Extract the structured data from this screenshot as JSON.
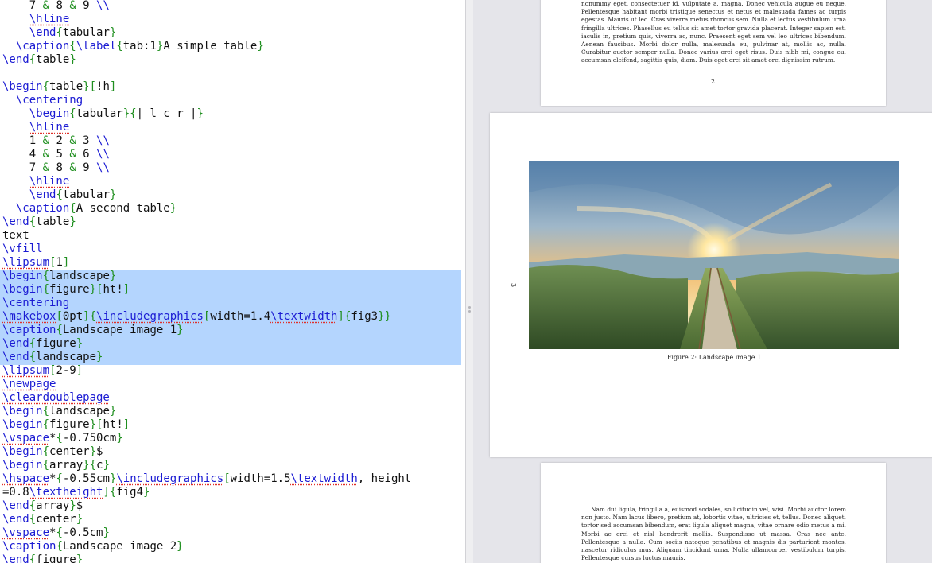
{
  "editor": {
    "lines": [
      [
        [
          "a",
          "    7 "
        ],
        [
          "b",
          "&"
        ],
        [
          "a",
          " 8 "
        ],
        [
          "b",
          "&"
        ],
        [
          "a",
          " 9 "
        ],
        [
          "c",
          "\\\\"
        ]
      ],
      [
        [
          "a",
          "    "
        ],
        [
          "u",
          "\\hline"
        ]
      ],
      [
        [
          "a",
          "    "
        ],
        [
          "c",
          "\\end"
        ],
        [
          "b",
          "{"
        ],
        [
          "a",
          "tabular"
        ],
        [
          "b",
          "}"
        ]
      ],
      [
        [
          "a",
          "  "
        ],
        [
          "c",
          "\\caption"
        ],
        [
          "b",
          "{"
        ],
        [
          "c",
          "\\label"
        ],
        [
          "b",
          "{"
        ],
        [
          "a",
          "tab:1"
        ],
        [
          "b",
          "}"
        ],
        [
          "a",
          "A simple table"
        ],
        [
          "b",
          "}"
        ]
      ],
      [
        [
          "c",
          "\\end"
        ],
        [
          "b",
          "{"
        ],
        [
          "a",
          "table"
        ],
        [
          "b",
          "}"
        ]
      ],
      [
        [
          "a",
          ""
        ]
      ],
      [
        [
          "c",
          "\\begin"
        ],
        [
          "b",
          "{"
        ],
        [
          "a",
          "table"
        ],
        [
          "b",
          "}"
        ],
        [
          "b",
          "["
        ],
        [
          "a",
          "!h"
        ],
        [
          "b",
          "]"
        ]
      ],
      [
        [
          "a",
          "  "
        ],
        [
          "c",
          "\\centering"
        ]
      ],
      [
        [
          "a",
          "    "
        ],
        [
          "c",
          "\\begin"
        ],
        [
          "b",
          "{"
        ],
        [
          "a",
          "tabular"
        ],
        [
          "b",
          "}"
        ],
        [
          "b",
          "{"
        ],
        [
          "a",
          "| l c r |"
        ],
        [
          "b",
          "}"
        ]
      ],
      [
        [
          "a",
          "    "
        ],
        [
          "u",
          "\\hline"
        ]
      ],
      [
        [
          "a",
          "    1 "
        ],
        [
          "b",
          "&"
        ],
        [
          "a",
          " 2 "
        ],
        [
          "b",
          "&"
        ],
        [
          "a",
          " 3 "
        ],
        [
          "c",
          "\\\\"
        ]
      ],
      [
        [
          "a",
          "    4 "
        ],
        [
          "b",
          "&"
        ],
        [
          "a",
          " 5 "
        ],
        [
          "b",
          "&"
        ],
        [
          "a",
          " 6 "
        ],
        [
          "c",
          "\\\\"
        ]
      ],
      [
        [
          "a",
          "    7 "
        ],
        [
          "b",
          "&"
        ],
        [
          "a",
          " 8 "
        ],
        [
          "b",
          "&"
        ],
        [
          "a",
          " 9 "
        ],
        [
          "c",
          "\\\\"
        ]
      ],
      [
        [
          "a",
          "    "
        ],
        [
          "u",
          "\\hline"
        ]
      ],
      [
        [
          "a",
          "    "
        ],
        [
          "c",
          "\\end"
        ],
        [
          "b",
          "{"
        ],
        [
          "a",
          "tabular"
        ],
        [
          "b",
          "}"
        ]
      ],
      [
        [
          "a",
          "  "
        ],
        [
          "c",
          "\\caption"
        ],
        [
          "b",
          "{"
        ],
        [
          "a",
          "A second table"
        ],
        [
          "b",
          "}"
        ]
      ],
      [
        [
          "c",
          "\\end"
        ],
        [
          "b",
          "{"
        ],
        [
          "a",
          "table"
        ],
        [
          "b",
          "}"
        ]
      ],
      [
        [
          "a",
          "text"
        ]
      ],
      [
        [
          "c",
          "\\vfill"
        ]
      ],
      [
        [
          "u",
          "\\lipsum"
        ],
        [
          "b",
          "["
        ],
        [
          "a",
          "1"
        ],
        [
          "b",
          "]"
        ]
      ],
      [
        [
          "c",
          "\\begin"
        ],
        [
          "b",
          "{"
        ],
        [
          "a",
          "landscape"
        ],
        [
          "b",
          "}"
        ]
      ],
      [
        [
          "c",
          "\\begin"
        ],
        [
          "b",
          "{"
        ],
        [
          "a",
          "figure"
        ],
        [
          "b",
          "}"
        ],
        [
          "b",
          "["
        ],
        [
          "a",
          "ht!"
        ],
        [
          "b",
          "]"
        ]
      ],
      [
        [
          "c",
          "\\centering"
        ]
      ],
      [
        [
          "u",
          "\\makebox"
        ],
        [
          "b",
          "["
        ],
        [
          "a",
          "0pt"
        ],
        [
          "b",
          "]"
        ],
        [
          "b",
          "{"
        ],
        [
          "u",
          "\\includegraphics"
        ],
        [
          "b",
          "["
        ],
        [
          "a",
          "width=1.4"
        ],
        [
          "u",
          "\\textwidth"
        ],
        [
          "b",
          "]"
        ],
        [
          "b",
          "{"
        ],
        [
          "a",
          "fig3"
        ],
        [
          "b",
          "}}"
        ]
      ],
      [
        [
          "c",
          "\\caption"
        ],
        [
          "b",
          "{"
        ],
        [
          "a",
          "Landscape image 1"
        ],
        [
          "b",
          "}"
        ]
      ],
      [
        [
          "c",
          "\\end"
        ],
        [
          "b",
          "{"
        ],
        [
          "a",
          "figure"
        ],
        [
          "b",
          "}"
        ]
      ],
      [
        [
          "c",
          "\\end"
        ],
        [
          "b",
          "{"
        ],
        [
          "a",
          "landscape"
        ],
        [
          "b",
          "}"
        ]
      ],
      [
        [
          "u",
          "\\lipsum"
        ],
        [
          "b",
          "["
        ],
        [
          "a",
          "2-9"
        ],
        [
          "b",
          "]"
        ]
      ],
      [
        [
          "u",
          "\\newpage"
        ]
      ],
      [
        [
          "u",
          "\\cleardoublepage"
        ]
      ],
      [
        [
          "c",
          "\\begin"
        ],
        [
          "b",
          "{"
        ],
        [
          "a",
          "landscape"
        ],
        [
          "b",
          "}"
        ]
      ],
      [
        [
          "c",
          "\\begin"
        ],
        [
          "b",
          "{"
        ],
        [
          "a",
          "figure"
        ],
        [
          "b",
          "}"
        ],
        [
          "b",
          "["
        ],
        [
          "a",
          "ht!"
        ],
        [
          "b",
          "]"
        ]
      ],
      [
        [
          "u",
          "\\vspace"
        ],
        [
          "a",
          "*"
        ],
        [
          "b",
          "{"
        ],
        [
          "a",
          "-0.750cm"
        ],
        [
          "b",
          "}"
        ]
      ],
      [
        [
          "c",
          "\\begin"
        ],
        [
          "b",
          "{"
        ],
        [
          "a",
          "center"
        ],
        [
          "b",
          "}"
        ],
        [
          "a",
          "$"
        ]
      ],
      [
        [
          "c",
          "\\begin"
        ],
        [
          "b",
          "{"
        ],
        [
          "a",
          "array"
        ],
        [
          "b",
          "}"
        ],
        [
          "b",
          "{"
        ],
        [
          "a",
          "c"
        ],
        [
          "b",
          "}"
        ]
      ],
      [
        [
          "u",
          "\\hspace"
        ],
        [
          "a",
          "*"
        ],
        [
          "b",
          "{"
        ],
        [
          "a",
          "-0.55cm"
        ],
        [
          "b",
          "}"
        ],
        [
          "u",
          "\\includegraphics"
        ],
        [
          "b",
          "["
        ],
        [
          "a",
          "width=1.5"
        ],
        [
          "u",
          "\\textwidth"
        ],
        [
          "a",
          ", height"
        ]
      ],
      [
        [
          "a",
          "=0.8"
        ],
        [
          "u",
          "\\textheight"
        ],
        [
          "b",
          "]"
        ],
        [
          "b",
          "{"
        ],
        [
          "a",
          "fig4"
        ],
        [
          "b",
          "}"
        ]
      ],
      [
        [
          "c",
          "\\end"
        ],
        [
          "b",
          "{"
        ],
        [
          "a",
          "array"
        ],
        [
          "b",
          "}"
        ],
        [
          "a",
          "$"
        ]
      ],
      [
        [
          "c",
          "\\end"
        ],
        [
          "b",
          "{"
        ],
        [
          "a",
          "center"
        ],
        [
          "b",
          "}"
        ]
      ],
      [
        [
          "u",
          "\\vspace"
        ],
        [
          "a",
          "*"
        ],
        [
          "b",
          "{"
        ],
        [
          "a",
          "-0.5cm"
        ],
        [
          "b",
          "}"
        ]
      ],
      [
        [
          "c",
          "\\caption"
        ],
        [
          "b",
          "{"
        ],
        [
          "a",
          "Landscape image 2"
        ],
        [
          "b",
          "}"
        ]
      ],
      [
        [
          "c",
          "\\end"
        ],
        [
          "b",
          "{"
        ],
        [
          "a",
          "figure"
        ],
        [
          "b",
          "}"
        ]
      ]
    ]
  },
  "preview": {
    "page2": {
      "text": "nonummy eget, consectetuer id, vulputate a, magna. Donec vehicula augue eu neque. Pellentesque habitant morbi tristique senectus et netus et malesuada fames ac turpis egestas. Mauris ut leo. Cras viverra metus rhoncus sem. Nulla et lectus vestibulum urna fringilla ultrices. Phasellus eu tellus sit amet tortor gravida placerat. Integer sapien est, iaculis in, pretium quis, viverra ac, nunc. Praesent eget sem vel leo ultrices bibendum. Aenean faucibus. Morbi dolor nulla, malesuada eu, pulvinar at, mollis ac, nulla. Curabitur auctor semper nulla. Donec varius orci eget risus. Duis nibh mi, congue eu, accumsan eleifend, sagittis quis, diam. Duis eget orci sit amet orci dignissim rutrum.",
      "page_number": "2"
    },
    "page3": {
      "page_number": "3",
      "caption": "Figure 2: Landscape image 1"
    },
    "page4": {
      "text": "Nam dui ligula, fringilla a, euismod sodales, sollicitudin vel, wisi. Morbi auctor lorem non justo. Nam lacus libero, pretium at, lobortis vitae, ultricies et, tellus. Donec aliquet, tortor sed accumsan bibendum, erat ligula aliquet magna, vitae ornare odio metus a mi. Morbi ac orci et nisl hendrerit mollis. Suspendisse ut massa. Cras nec ante. Pellentesque a nulla. Cum sociis natoque penatibus et magnis dis parturient montes, nascetur ridiculus mus. Aliquam tincidunt urna. Nulla ullamcorper vestibulum turpis. Pellentesque cursus luctus mauris."
    }
  },
  "colors": {
    "command": "#1b1bd3",
    "brace": "#1f8f1f",
    "selection": "#b4d5fe",
    "preview_bg": "#e5e5ea"
  }
}
